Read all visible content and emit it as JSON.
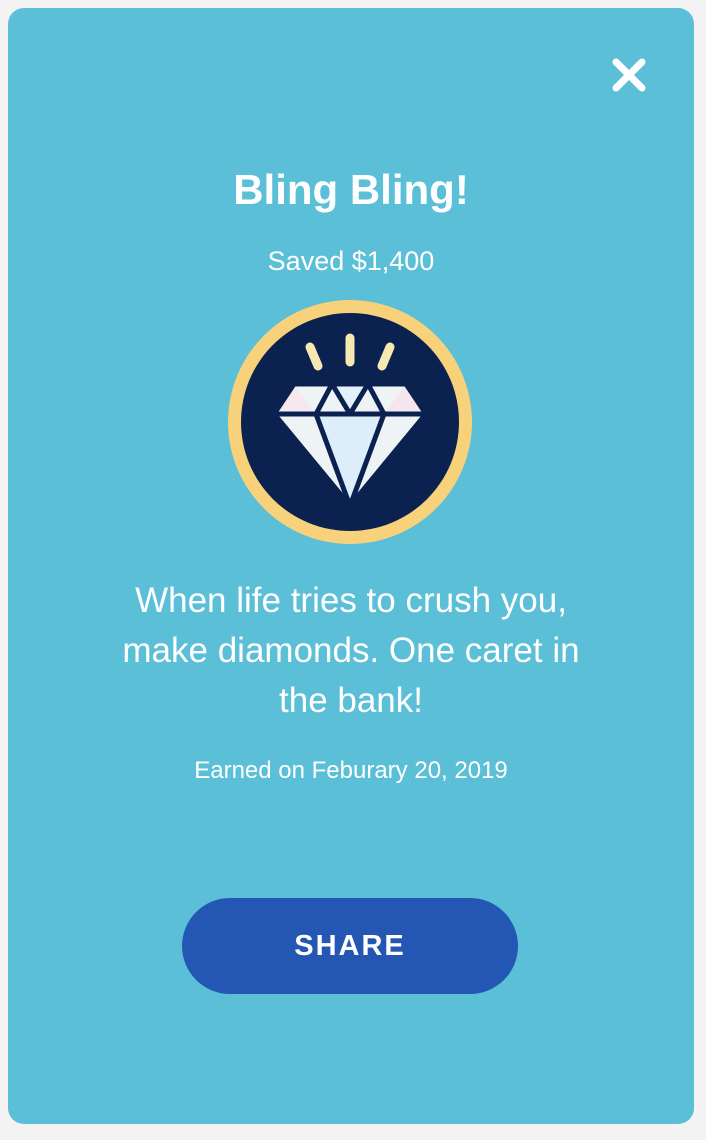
{
  "modal": {
    "close_icon": "close-icon",
    "title": "Bling Bling!",
    "subtitle": "Saved $1,400",
    "badge_icon": "diamond-icon",
    "message": "When life tries to crush you, make diamonds. One caret in the bank!",
    "earned": "Earned on Feburary 20, 2019",
    "share_label": "SHARE"
  },
  "colors": {
    "background": "#5bbfd7",
    "badge_ring": "#f7d27a",
    "badge_fill": "#0b2250",
    "button": "#2457b3",
    "text": "#ffffff"
  }
}
